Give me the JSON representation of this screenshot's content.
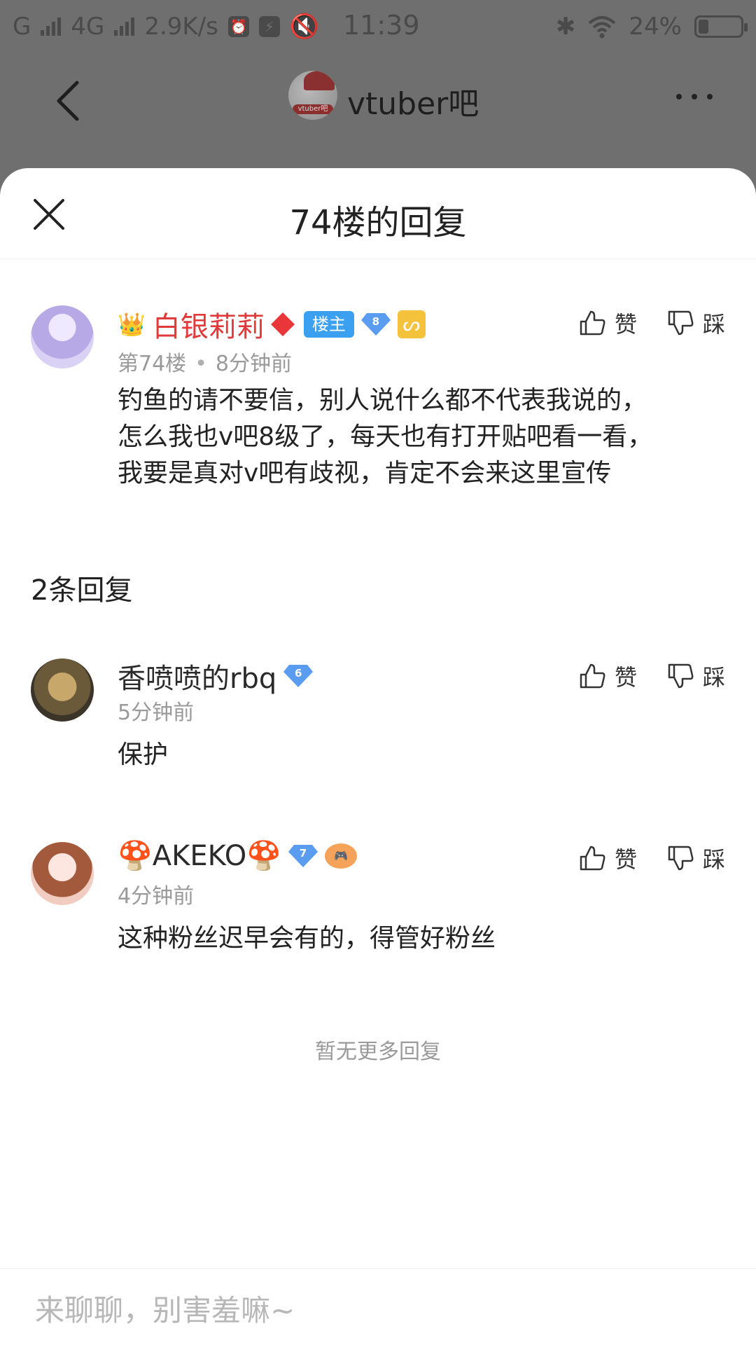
{
  "status_bar": {
    "signal1": "G",
    "signal2": "4G",
    "speed": "2.9K/s",
    "time": "11:39",
    "battery": "24%",
    "battery_level": 0.24
  },
  "top_nav": {
    "forum_name": "vtuber吧",
    "forum_avatar_tag": "vtuber吧"
  },
  "sheet": {
    "title": "74楼的回复",
    "replies_count": "2条回复",
    "no_more": "暂无更多回复",
    "input_placeholder": "来聊聊，别害羞嘛~"
  },
  "op_post": {
    "author": "白银莉莉",
    "op_badge": "楼主",
    "level": "8",
    "floor": "第74楼",
    "time": "8分钟前",
    "content_lines": [
      "钓鱼的请不要信，别人说什么都不代表我说的，",
      "怎么我也v吧8级了，每天也有打开贴吧看一看，",
      "我要是真对v吧有歧视，肯定不会来这里宣传"
    ],
    "like_label": "赞",
    "dislike_label": "踩"
  },
  "replies": [
    {
      "author": "香喷喷的rbq",
      "level": "6",
      "time": "5分钟前",
      "content": "保护",
      "like_label": "赞",
      "dislike_label": "踩"
    },
    {
      "author": "🍄AKEKO🍄",
      "level": "7",
      "time": "4分钟前",
      "content": "这种粉丝迟早会有的，得管好粉丝",
      "like_label": "赞",
      "dislike_label": "踩"
    }
  ]
}
